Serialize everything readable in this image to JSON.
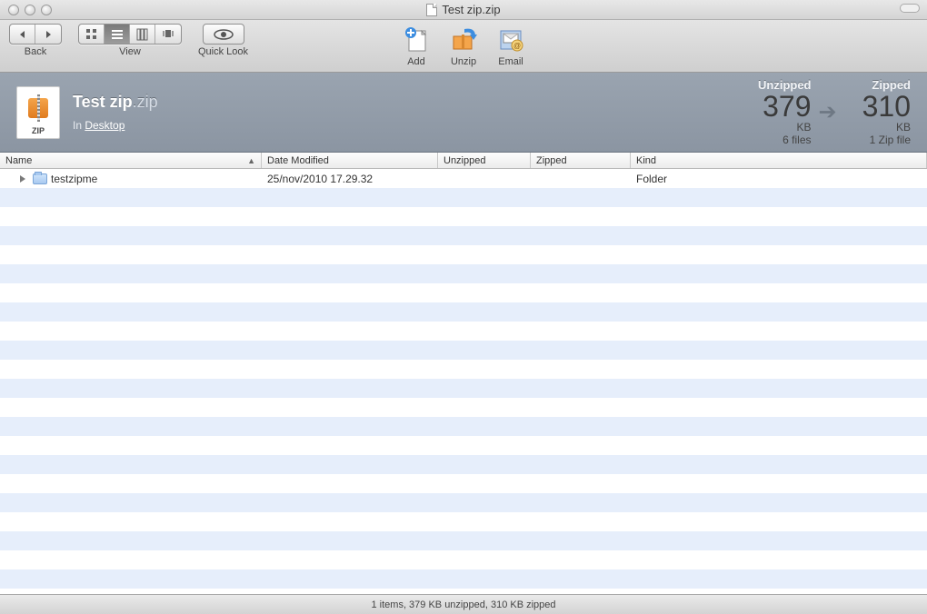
{
  "window": {
    "title": "Test zip.zip"
  },
  "toolbar": {
    "back_label": "Back",
    "view_label": "View",
    "quicklook_label": "Quick Look",
    "add_label": "Add",
    "unzip_label": "Unzip",
    "email_label": "Email"
  },
  "info": {
    "file_name": "Test zip",
    "file_ext": ".zip",
    "location_prefix": "In ",
    "location_link": "Desktop",
    "unzipped": {
      "label": "Unzipped",
      "value": "379",
      "unit": "KB",
      "sub": "6 files"
    },
    "zipped": {
      "label": "Zipped",
      "value": "310",
      "unit": "KB",
      "sub": "1 Zip file"
    }
  },
  "columns": {
    "name": "Name",
    "date": "Date Modified",
    "unzipped": "Unzipped",
    "zipped": "Zipped",
    "kind": "Kind"
  },
  "rows": [
    {
      "name": "testzipme",
      "date": "25/nov/2010 17.29.32",
      "unzipped": "",
      "zipped": "",
      "kind": "Folder"
    }
  ],
  "status": "1 items, 379 KB unzipped, 310 KB zipped"
}
